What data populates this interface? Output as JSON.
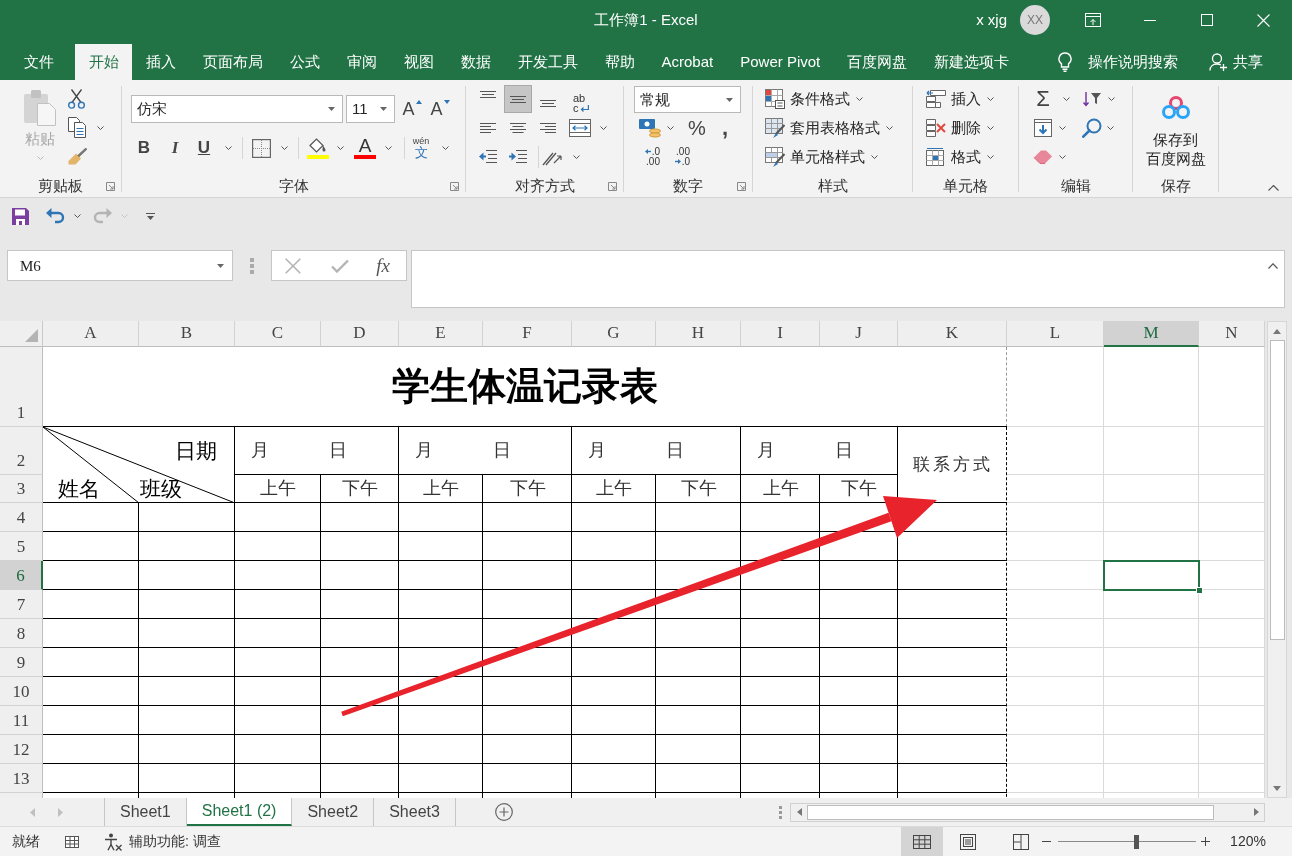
{
  "window": {
    "title": "工作簿1 - Excel",
    "user": "x xjg",
    "avatar": "XX"
  },
  "ribbon_tabs": [
    {
      "label": "文件",
      "selected": false
    },
    {
      "label": "开始",
      "selected": true
    },
    {
      "label": "插入",
      "selected": false
    },
    {
      "label": "页面布局",
      "selected": false
    },
    {
      "label": "公式",
      "selected": false
    },
    {
      "label": "审阅",
      "selected": false
    },
    {
      "label": "视图",
      "selected": false
    },
    {
      "label": "数据",
      "selected": false
    },
    {
      "label": "开发工具",
      "selected": false
    },
    {
      "label": "帮助",
      "selected": false
    },
    {
      "label": "Acrobat",
      "selected": false
    },
    {
      "label": "Power Pivot",
      "selected": false
    },
    {
      "label": "百度网盘",
      "selected": false
    },
    {
      "label": "新建选项卡",
      "selected": false
    }
  ],
  "tell_me": "操作说明搜索",
  "share": "共享",
  "ribbon": {
    "clipboard": {
      "label": "剪贴板",
      "paste": {
        "label": "粘贴",
        "disabled": true
      }
    },
    "font": {
      "label": "字体",
      "font_name": "仿宋",
      "font_size": "11",
      "size_buttons": [
        {
          "kind": "grow",
          "label": "A"
        },
        {
          "kind": "shrink",
          "label": "A"
        }
      ],
      "style_buttons": [
        {
          "kind": "bold",
          "label": "B"
        },
        {
          "kind": "italic",
          "label": "I"
        },
        {
          "kind": "underline",
          "label": "U"
        }
      ],
      "font_color": "A",
      "phonetic": [
        "wén",
        "文"
      ]
    },
    "alignment": {
      "label": "对齐方式",
      "vertical": [
        {
          "kind": "top",
          "selected": false
        },
        {
          "kind": "middle",
          "selected": true
        },
        {
          "kind": "bottom",
          "selected": false
        }
      ],
      "horizontal": [
        {
          "kind": "left",
          "selected": false
        },
        {
          "kind": "center",
          "selected": false
        },
        {
          "kind": "right",
          "selected": false
        }
      ],
      "wrap_text": [
        "ab",
        "c"
      ]
    },
    "number": {
      "label": "数字",
      "format": "常规",
      "percent": "%",
      "comma": ",",
      "decimal_buttons": [
        {
          "kind": "increase",
          "lines": [
            ".0",
            ".00"
          ]
        },
        {
          "kind": "decrease",
          "lines": [
            ".00",
            ".0"
          ]
        }
      ]
    },
    "styles": {
      "label": "样式",
      "items": [
        {
          "kind": "conditional",
          "label": "条件格式"
        },
        {
          "kind": "table",
          "label": "套用表格格式"
        },
        {
          "kind": "cell",
          "label": "单元格样式"
        }
      ]
    },
    "cells": {
      "label": "单元格",
      "items": [
        {
          "kind": "insert",
          "label": "插入"
        },
        {
          "kind": "delete",
          "label": "删除"
        },
        {
          "kind": "format",
          "label": "格式"
        }
      ]
    },
    "editing": {
      "label": "编辑",
      "autosum": "Σ"
    },
    "save": {
      "label": "保存",
      "button_lines": [
        "保存到",
        "百度网盘"
      ]
    }
  },
  "quick_access": [
    {
      "kind": "save",
      "disabled": false
    },
    {
      "kind": "undo",
      "disabled": false
    },
    {
      "kind": "redo",
      "disabled": true
    }
  ],
  "formula_bar": {
    "name_box": "M6",
    "function_button": "fx"
  },
  "sheet": {
    "columns": [
      {
        "label": "A",
        "selected": false
      },
      {
        "label": "B",
        "selected": false
      },
      {
        "label": "C",
        "selected": false
      },
      {
        "label": "D",
        "selected": false
      },
      {
        "label": "E",
        "selected": false
      },
      {
        "label": "F",
        "selected": false
      },
      {
        "label": "G",
        "selected": false
      },
      {
        "label": "H",
        "selected": false
      },
      {
        "label": "I",
        "selected": false
      },
      {
        "label": "J",
        "selected": false
      },
      {
        "label": "K",
        "selected": false
      },
      {
        "label": "L",
        "selected": false
      },
      {
        "label": "M",
        "selected": true
      },
      {
        "label": "N",
        "selected": false
      }
    ],
    "rows": [
      {
        "label": "1",
        "selected": false
      },
      {
        "label": "2",
        "selected": false
      },
      {
        "label": "3",
        "selected": false
      },
      {
        "label": "4",
        "selected": false
      },
      {
        "label": "5",
        "selected": false
      },
      {
        "label": "6",
        "selected": true
      },
      {
        "label": "7",
        "selected": false
      },
      {
        "label": "8",
        "selected": false
      },
      {
        "label": "9",
        "selected": false
      },
      {
        "label": "10",
        "selected": false
      },
      {
        "label": "11",
        "selected": false
      },
      {
        "label": "12",
        "selected": false
      },
      {
        "label": "13",
        "selected": false
      }
    ],
    "title": "学生体温记录表",
    "corner_header": {
      "top": "日期",
      "left": "姓名",
      "middle": "班级"
    },
    "dates": [
      {
        "month": "月",
        "day": "日"
      },
      {
        "month": "月",
        "day": "日"
      },
      {
        "month": "月",
        "day": "日"
      },
      {
        "month": "月",
        "day": "日"
      }
    ],
    "periods": [
      "上午",
      "下午",
      "上午",
      "下午",
      "上午",
      "下午",
      "上午",
      "下午"
    ],
    "contact": "联系方式"
  },
  "sheet_nav": [
    {
      "kind": "previous",
      "disabled": true
    },
    {
      "kind": "next",
      "disabled": true
    }
  ],
  "sheet_tabs": [
    {
      "label": "Sheet1",
      "selected": false
    },
    {
      "label": "Sheet1 (2)",
      "selected": true
    },
    {
      "label": "Sheet2",
      "selected": false
    },
    {
      "label": "Sheet3",
      "selected": false
    }
  ],
  "status_bar": {
    "status": "就绪",
    "accessibility": "辅助功能: 调查",
    "views": [
      {
        "kind": "normal",
        "selected": true
      },
      {
        "kind": "page_layout",
        "selected": false
      },
      {
        "kind": "page_break",
        "selected": false
      }
    ],
    "zoom": {
      "level": 0.57,
      "reading": "120%"
    }
  },
  "annotations": [
    {
      "kind": "arrow"
    }
  ]
}
